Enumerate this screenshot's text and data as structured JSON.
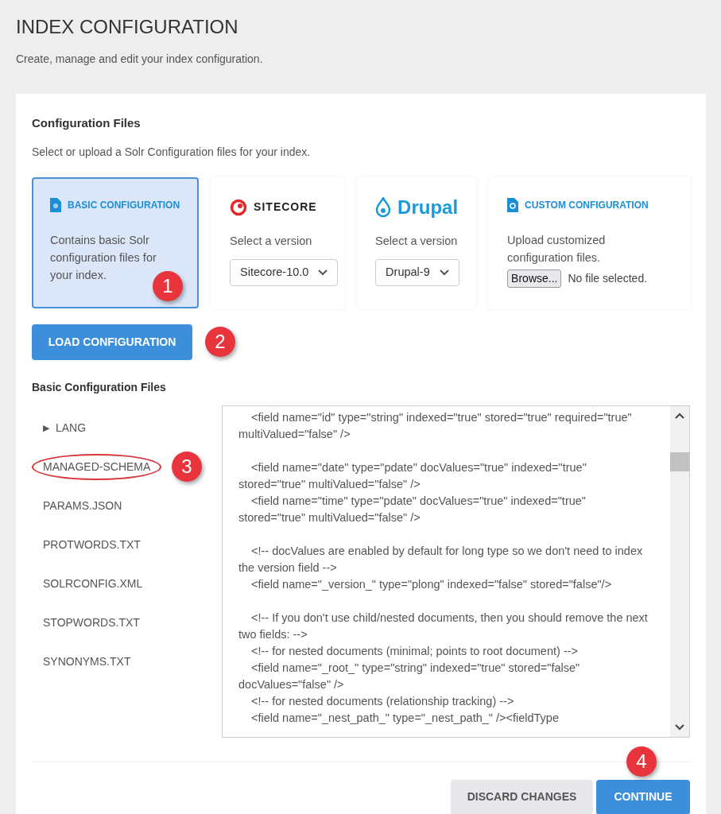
{
  "page": {
    "title": "INDEX CONFIGURATION",
    "subtitle": "Create, manage and edit your index configuration."
  },
  "section": {
    "title": "Configuration Files",
    "description": "Select or upload a Solr Configuration files for your index."
  },
  "config_cards": [
    {
      "kind": "basic",
      "selected": true,
      "title": "BASIC CONFIGURATION",
      "description": "Contains basic Solr configuration files for your index.",
      "callout": "1"
    },
    {
      "kind": "sitecore",
      "selected": false,
      "logo_text": "SITECORE",
      "label": "Select a version",
      "value": "Sitecore-10.0"
    },
    {
      "kind": "drupal",
      "selected": false,
      "logo_text": "Drupal",
      "label": "Select a version",
      "value": "Drupal-9"
    },
    {
      "kind": "custom",
      "selected": false,
      "title": "CUSTOM CONFIGURATION",
      "description": "Upload customized configuration files.",
      "browse": "Browse...",
      "file_status": "No file selected."
    }
  ],
  "load_button": {
    "label": "LOAD CONFIGURATION",
    "callout": "2"
  },
  "files": {
    "title": "Basic Configuration Files",
    "items": [
      {
        "kind": "folder",
        "toggle": "▶",
        "name": "LANG",
        "expanded": false,
        "circled": false
      },
      {
        "kind": "file",
        "name": "MANAGED-SCHEMA",
        "circled": true,
        "callout": "3"
      },
      {
        "kind": "file",
        "name": "PARAMS.JSON",
        "circled": false
      },
      {
        "kind": "file",
        "name": "PROTWORDS.TXT",
        "circled": false
      },
      {
        "kind": "file",
        "name": "SOLRCONFIG.XML",
        "circled": false
      },
      {
        "kind": "file",
        "name": "STOPWORDS.TXT",
        "circled": false
      },
      {
        "kind": "file",
        "name": "SYNONYMS.TXT",
        "circled": false
      }
    ]
  },
  "editor": {
    "blocks": [
      [
        "<field name=\"id\" type=\"string\" indexed=\"true\" stored=\"true\" required=\"true\" multiValued=\"false\" />"
      ],
      [
        "<field name=\"date\" type=\"pdate\" docValues=\"true\" indexed=\"true\" stored=\"true\" multiValued=\"false\" />",
        "<field name=\"time\" type=\"pdate\" docValues=\"true\" indexed=\"true\" stored=\"true\" multiValued=\"false\" />"
      ],
      [
        "<!-- docValues are enabled by default for long type so we don't need to index the version field  -->",
        "<field name=\"_version_\" type=\"plong\" indexed=\"false\" stored=\"false\"/>"
      ],
      [
        "<!-- If you don't use child/nested documents, then you should remove the next two fields:  -->",
        "<!-- for nested documents (minimal; points to root document) -->",
        "<field name=\"_root_\" type=\"string\" indexed=\"true\" stored=\"false\" docValues=\"false\" />",
        "<!-- for nested documents (relationship tracking) -->",
        "<field name=\"_nest_path_\" type=\"_nest_path_\" /><fieldType"
      ]
    ]
  },
  "footer": {
    "callout": "4",
    "buttons": [
      {
        "kind": "secondary",
        "label": "DISCARD CHANGES"
      },
      {
        "kind": "primary",
        "label": "CONTINUE"
      }
    ]
  }
}
